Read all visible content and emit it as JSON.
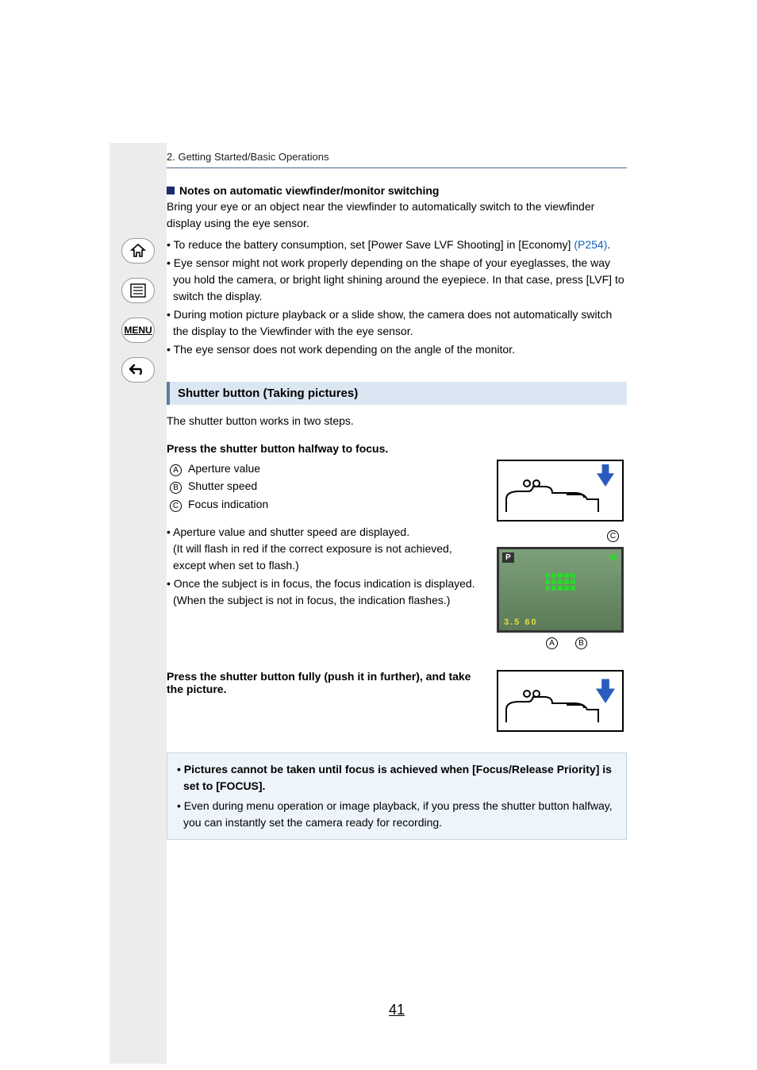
{
  "chapter": "2. Getting Started/Basic Operations",
  "nav": {
    "home_icon": "home-icon",
    "toc_icon": "toc-icon",
    "menu_label": "MENU",
    "back_icon": "back-icon"
  },
  "notes": {
    "heading": "Notes on automatic viewfinder/monitor switching",
    "intro": "Bring your eye or an object near the viewfinder to automatically switch to the viewfinder display using the eye sensor.",
    "bullets": [
      {
        "pre": "To reduce the battery consumption, set [Power Save LVF Shooting] in [Economy] ",
        "link": "(P254)",
        "post": "."
      },
      {
        "pre": "Eye sensor might not work properly depending on the shape of your eyeglasses, the way you hold the camera, or bright light shining around the eyepiece. In that case, press [LVF] to switch the display.",
        "link": "",
        "post": ""
      },
      {
        "pre": "During motion picture playback or a slide show, the camera does not automatically switch the display to the Viewfinder with the eye sensor.",
        "link": "",
        "post": ""
      },
      {
        "pre": "The eye sensor does not work depending on the angle of the monitor.",
        "link": "",
        "post": ""
      }
    ]
  },
  "section": {
    "title": "Shutter button (Taking pictures)",
    "intro": "The shutter button works in two steps."
  },
  "step1": {
    "heading": "Press the shutter button halfway to focus.",
    "legend": [
      {
        "badge": "A",
        "text": "Aperture value"
      },
      {
        "badge": "B",
        "text": "Shutter speed"
      },
      {
        "badge": "C",
        "text": "Focus indication"
      }
    ],
    "bullets": [
      "Aperture value and shutter speed are displayed.\n(It will flash in red if the correct exposure is not achieved, except when set to flash.)",
      "Once the subject is in focus, the focus indication is displayed.\n(When the subject is not in focus, the indication flashes.)"
    ],
    "screen": {
      "mode_badge": "P",
      "aperture": "3.5",
      "shutter": "60",
      "label_c": "C",
      "label_a": "A",
      "label_b": "B"
    }
  },
  "step2": {
    "heading": "Press the shutter button fully (push it in further), and take the picture."
  },
  "info": {
    "bold_bullet": "Pictures cannot be taken until focus is achieved when [Focus/Release Priority] is set to [FOCUS].",
    "bullet": "Even during menu operation or image playback, if you press the shutter button halfway, you can instantly set the camera ready for recording."
  },
  "page_number": "41"
}
